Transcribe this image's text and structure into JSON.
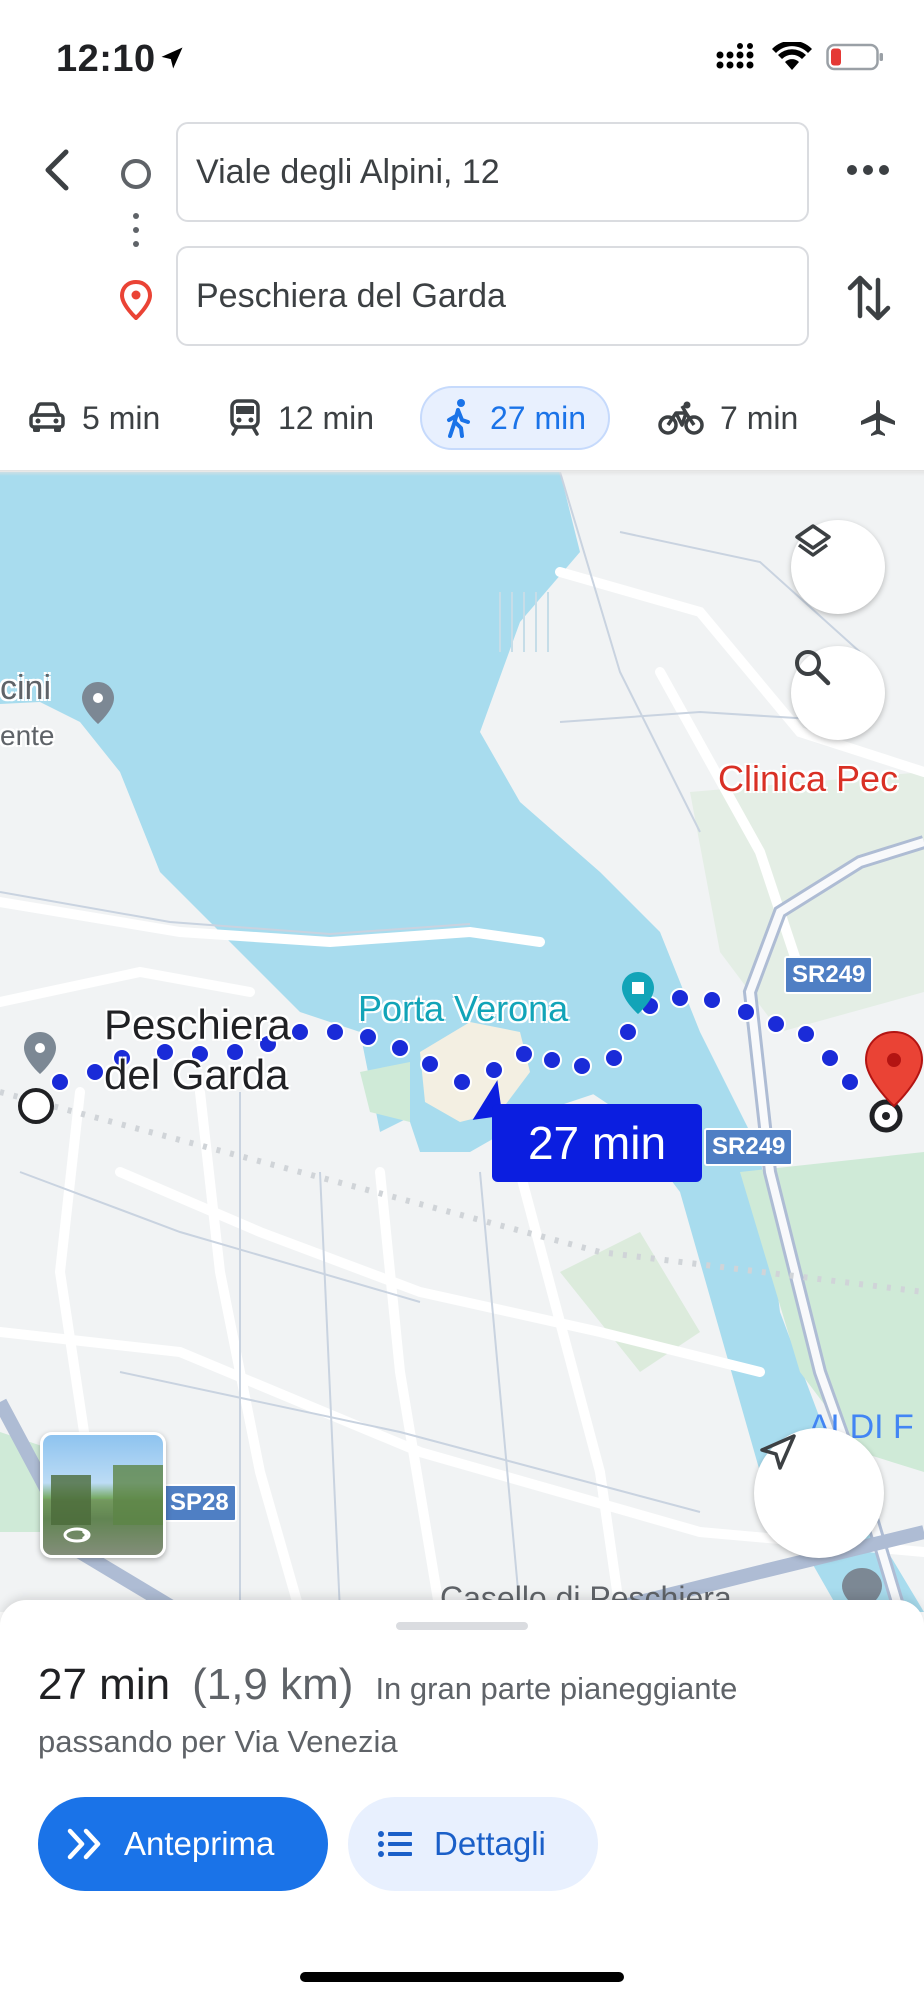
{
  "status_bar": {
    "time": "12:10"
  },
  "route": {
    "origin": "Viale degli Alpini, 12",
    "destination": "Peschiera del Garda"
  },
  "modes": [
    {
      "label": "5 min",
      "icon": "car-icon"
    },
    {
      "label": "12 min",
      "icon": "train-icon"
    },
    {
      "label": "27 min",
      "icon": "walk-icon",
      "active": true
    },
    {
      "label": "7 min",
      "icon": "bike-icon"
    },
    {
      "label": "",
      "icon": "flight-icon"
    }
  ],
  "map": {
    "labels": {
      "city_line1": "Peschiera",
      "city_line2": "del Garda",
      "porta_verona": "Porta Verona",
      "clinica": "Clinica Pec",
      "cini": "cini",
      "ente": "ente",
      "aldi": "ALDI F",
      "casello": "Casello di Peschiera"
    },
    "shields": [
      "SR249",
      "SR249",
      "SP28"
    ],
    "route_time_badge": "27 min"
  },
  "summary": {
    "time": "27 min",
    "distance": "(1,9 km)",
    "description": "In gran parte pianeggiante",
    "via": "passando per Via Venezia"
  },
  "actions": {
    "preview_label": "Anteprima",
    "details_label": "Dettagli"
  },
  "colors": {
    "accent": "#1a73e8",
    "route_dots": "#1a2bd8",
    "water": "#a8dcee",
    "destination_pin": "#ea4335",
    "badge": "#0b1ee0"
  }
}
